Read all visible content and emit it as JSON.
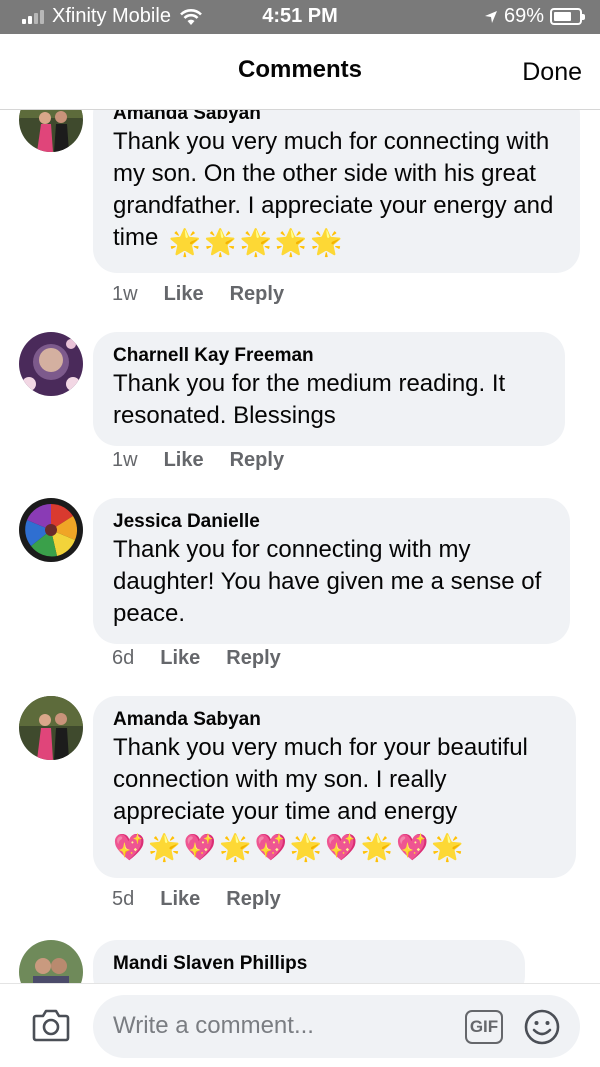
{
  "status_bar": {
    "carrier": "Xfinity Mobile",
    "time": "4:51 PM",
    "battery_text": "69%",
    "battery_level": 0.69
  },
  "header": {
    "title": "Comments",
    "done_label": "Done"
  },
  "comments": [
    {
      "name": "Amanda Sabyan",
      "text": "Thank you very much for connecting with my son. On the other side with his great grandfather. I appreciate your energy and time",
      "emojis": [
        "🌟",
        "🌟",
        "🌟",
        "🌟",
        "🌟"
      ],
      "time": "1w",
      "like_label": "Like",
      "reply_label": "Reply"
    },
    {
      "name": "Charnell Kay Freeman",
      "text": "Thank you for the medium reading.  It resonated. Blessings",
      "time": "1w",
      "like_label": "Like",
      "reply_label": "Reply"
    },
    {
      "name": "Jessica Danielle",
      "text": "Thank you for connecting with my daughter!  You have given me a sense of peace.",
      "time": "6d",
      "like_label": "Like",
      "reply_label": "Reply"
    },
    {
      "name": "Amanda Sabyan",
      "text": "Thank you very much for your beautiful connection with my son. I really appreciate your time and energy",
      "emojis": [
        "💖",
        "🌟",
        "💖",
        "🌟",
        "💖",
        "🌟",
        "💖",
        "🌟",
        "💖",
        "🌟"
      ],
      "time": "5d",
      "like_label": "Like",
      "reply_label": "Reply"
    },
    {
      "name": "Mandi Slaven Phillips"
    }
  ],
  "composer": {
    "placeholder": "Write a comment...",
    "gif_label": "GIF"
  }
}
